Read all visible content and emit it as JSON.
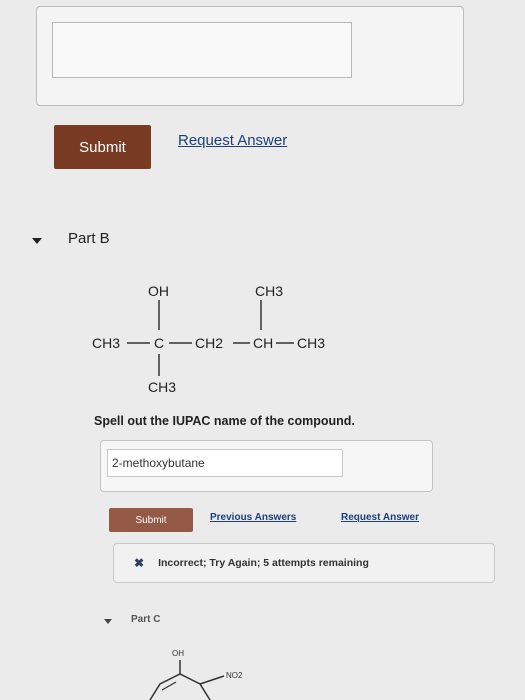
{
  "part_a": {
    "submit_label": "Submit",
    "request_answer_label": "Request Answer"
  },
  "part_b": {
    "title": "Part B",
    "molecule": {
      "oh": "OH",
      "ch3_top": "CH3",
      "ch3_left": "CH3",
      "c_center": "C",
      "ch2": "CH2",
      "ch": "CH",
      "ch3_right": "CH3",
      "ch3_bottom": "CH3"
    },
    "question": "Spell out the IUPAC name of the compound.",
    "answer_value": "2-methoxybutane",
    "submit_label": "Submit",
    "previous_answers_label": "Previous Answers",
    "request_answer_label": "Request Answer",
    "feedback": "Incorrect; Try Again; 5 attempts remaining",
    "feedback_icon": "x-icon"
  },
  "part_c": {
    "title": "Part C",
    "oh": "OH",
    "no2": "NO2"
  }
}
